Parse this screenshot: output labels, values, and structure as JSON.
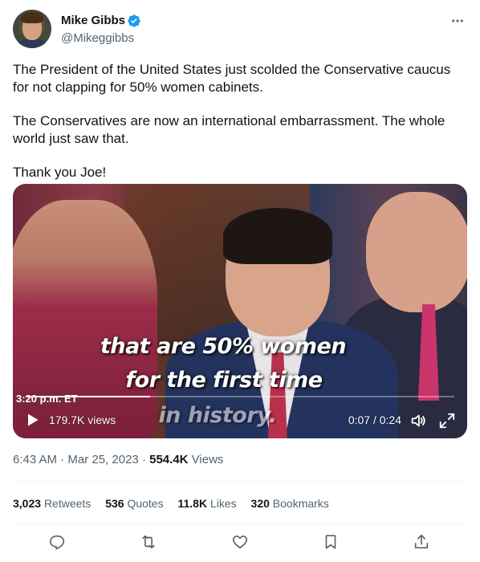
{
  "author": {
    "display_name": "Mike Gibbs",
    "handle": "@Mikeggibbs"
  },
  "tweet": {
    "paragraphs": [
      "The President of the United States just scolded the Conservative caucus for not clapping for 50% women cabinets.",
      "The Conservatives are now an international embarrassment. The whole world just saw that.",
      "Thank you Joe!"
    ]
  },
  "video": {
    "caption_lines": [
      "that are 50% women",
      "for the first time",
      "in history."
    ],
    "broadcast_time": "3:20 p.m. ET",
    "views": "179.7K views",
    "time": "0:07 / 0:24",
    "progress": 0.29
  },
  "meta": {
    "time": "6:43 AM",
    "separator": "·",
    "date": "Mar 25, 2023",
    "views_count": "554.4K",
    "views_label": "Views"
  },
  "stats": {
    "retweets_count": "3,023",
    "retweets_label": "Retweets",
    "quotes_count": "536",
    "quotes_label": "Quotes",
    "likes_count": "11.8K",
    "likes_label": "Likes",
    "bookmarks_count": "320",
    "bookmarks_label": "Bookmarks"
  },
  "icons": {
    "verified": "verified-badge-icon",
    "more": "more-icon",
    "reply": "reply-icon",
    "retweet": "retweet-icon",
    "like": "heart-icon",
    "bookmark": "bookmark-icon",
    "share": "share-icon",
    "play": "play-icon",
    "volume": "volume-icon",
    "fullscreen": "fullscreen-icon"
  },
  "colors": {
    "accent": "#1d9bf0",
    "text": "#0f1419",
    "secondary": "#536471"
  }
}
